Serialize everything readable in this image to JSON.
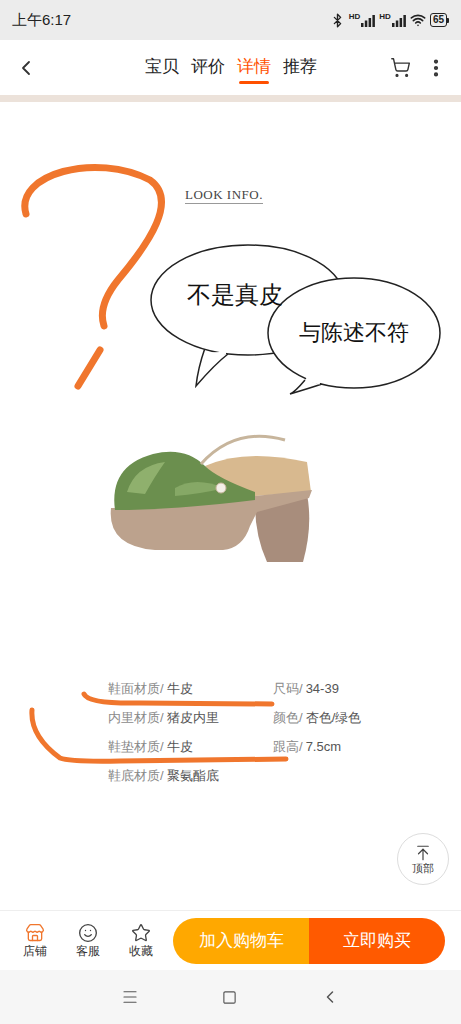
{
  "status_bar": {
    "time": "上午6:17",
    "signal_labels": [
      "HD",
      "HD"
    ],
    "battery": "65"
  },
  "nav": {
    "tabs": [
      {
        "label": "宝贝",
        "selected": false
      },
      {
        "label": "评价",
        "selected": false
      },
      {
        "label": "详情",
        "selected": true
      },
      {
        "label": "推荐",
        "selected": false
      }
    ]
  },
  "detail": {
    "heading": "LOOK INFO.",
    "annotations": [
      {
        "text": "不是真皮"
      },
      {
        "text": "与陈述不符"
      }
    ],
    "specs_left": [
      {
        "label": "鞋面材质/",
        "value": "牛皮"
      },
      {
        "label": "内里材质/",
        "value": "猪皮内里"
      },
      {
        "label": "鞋垫材质/",
        "value": "牛皮"
      },
      {
        "label": "鞋底材质/",
        "value": "聚氨酯底"
      }
    ],
    "specs_right": [
      {
        "label": "尺码/",
        "value": "34-39"
      },
      {
        "label": "颜色/",
        "value": "杏色/绿色"
      },
      {
        "label": "跟高/",
        "value": "7.5cm"
      }
    ]
  },
  "scroll_top": {
    "label": "顶部"
  },
  "bottom_bar": {
    "actions": [
      {
        "label": "店铺"
      },
      {
        "label": "客服"
      },
      {
        "label": "收藏"
      }
    ],
    "buttons": [
      {
        "label": "加入购物车",
        "color": "#ffa800"
      },
      {
        "label": "立即购买",
        "color": "#ff5a00"
      }
    ]
  }
}
